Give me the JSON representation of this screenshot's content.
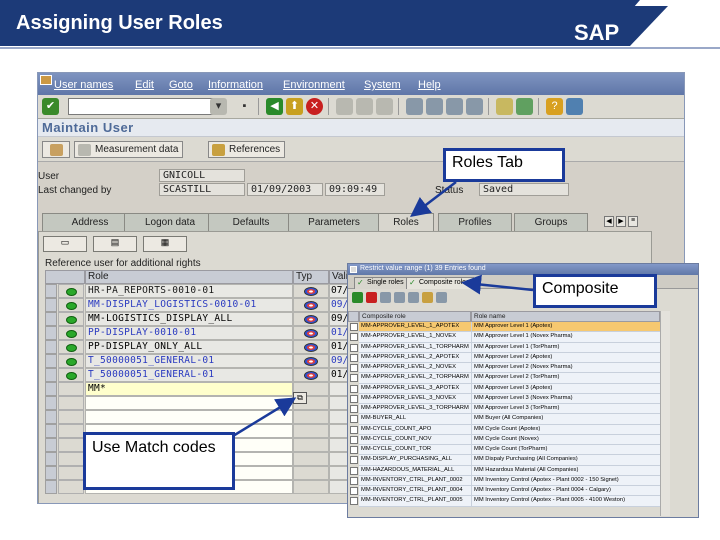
{
  "slide": {
    "title": "Assigning User Roles",
    "logo_text": "SAP"
  },
  "menubar": {
    "items": [
      "User names",
      "Edit",
      "Goto",
      "Information",
      "Environment",
      "System",
      "Help"
    ]
  },
  "screen": {
    "title": "Maintain User",
    "buttons": [
      "Measurement data",
      "References"
    ]
  },
  "header_fields": {
    "user_label": "User",
    "user_value": "GNICOLL",
    "last_changed_label": "Last changed by",
    "last_changed_value": "SCASTILL",
    "date_value": "01/09/2003",
    "time_value": "09:09:49",
    "status_label": "Status",
    "status_value": "Saved"
  },
  "tabs": [
    "Address",
    "Logon data",
    "Defaults",
    "Parameters",
    "Roles",
    "Profiles",
    "Groups"
  ],
  "active_tab": "Roles",
  "roles_grid": {
    "title": "Reference user for additional rights",
    "columns": [
      "Role",
      "Typ",
      "Vali"
    ],
    "rows": [
      {
        "role": "HR-PA_REPORTS-0010-01",
        "valid": "07/"
      },
      {
        "role": "MM-DISPLAY_LOGISTICS-0010-01",
        "valid": "09/"
      },
      {
        "role": "MM-LOGISTICS_DISPLAY_ALL",
        "valid": "09/"
      },
      {
        "role": "PP-DISPLAY-0010-01",
        "valid": "01/"
      },
      {
        "role": "PP-DISPLAY_ONLY_ALL",
        "valid": "01/"
      },
      {
        "role": "T_50000051_GENERAL-01",
        "valid": "09/"
      },
      {
        "role": "T_50000051_GENERAL-01",
        "valid": "01/"
      }
    ],
    "input_value": "MM*"
  },
  "popup": {
    "title": "Restrict value range (1)   39 Entries found",
    "tabs": [
      "Single roles",
      "Composite roles"
    ],
    "active_tab": "Composite roles",
    "columns": [
      "Composite role",
      "Role name"
    ],
    "rows": [
      {
        "role": "MM-APPROVER_LEVEL_1_APOTEX",
        "name": "MM Approver Level 1 (Apotex)"
      },
      {
        "role": "MM-APPROVER_LEVEL_1_NOVEX",
        "name": "MM Approver Level 1 (Novex Pharma)"
      },
      {
        "role": "MM-APPROVER_LEVEL_1_TORPHARM",
        "name": "MM Approver Level 1 (TorPharm)"
      },
      {
        "role": "MM-APPROVER_LEVEL_2_APOTEX",
        "name": "MM Approver Level 2 (Apotex)"
      },
      {
        "role": "MM-APPROVER_LEVEL_2_NOVEX",
        "name": "MM Approver Level 2 (Novex Pharma)"
      },
      {
        "role": "MM-APPROVER_LEVEL_2_TORPHARM",
        "name": "MM Approver Level 2 (TorPharm)"
      },
      {
        "role": "MM-APPROVER_LEVEL_3_APOTEX",
        "name": "MM Approver Level 3 (Apotex)"
      },
      {
        "role": "MM-APPROVER_LEVEL_3_NOVEX",
        "name": "MM Approver Level 3 (Novex Pharma)"
      },
      {
        "role": "MM-APPROVER_LEVEL_3_TORPHARM",
        "name": "MM Approver Level 3 (TorPharm)"
      },
      {
        "role": "MM-BUYER_ALL",
        "name": "MM Buyer (All Companies)"
      },
      {
        "role": "MM-CYCLE_COUNT_APO",
        "name": "MM Cycle Count (Apotex)"
      },
      {
        "role": "MM-CYCLE_COUNT_NOV",
        "name": "MM Cycle Count (Novex)"
      },
      {
        "role": "MM-CYCLE_COUNT_TOR",
        "name": "MM Cycle Count (TorPharm)"
      },
      {
        "role": "MM-DISPLAY_PURCHASING_ALL",
        "name": "MM Dispaly Purchasing (All Companies)"
      },
      {
        "role": "MM-HAZARDOUS_MATERIAL_ALL",
        "name": "MM Hazardous Material (All Companies)"
      },
      {
        "role": "MM-INVENTORY_CTRL_PLANT_0002",
        "name": "MM Inventory Control (Apotex - Plant 0002 - 150 Signet)"
      },
      {
        "role": "MM-INVENTORY_CTRL_PLANT_0004",
        "name": "MM Inventory Control (Apotex - Plant 0004 - Calgary)"
      },
      {
        "role": "MM-INVENTORY_CTRL_PLANT_0005",
        "name": "MM Inventory Control (Apotex - Plant 0005 - 4100 Weston)"
      }
    ]
  },
  "callouts": {
    "roles_tab": "Roles Tab",
    "composite": "Composite",
    "match_codes": "Use Match codes"
  },
  "colors": {
    "slide_title_bg": "#1c3a78",
    "callout_border": "#1a3a9a",
    "sap_screen_title": "#4e6a98",
    "highlight_row": "#f6c870",
    "status_ok": "#2aa82a"
  }
}
